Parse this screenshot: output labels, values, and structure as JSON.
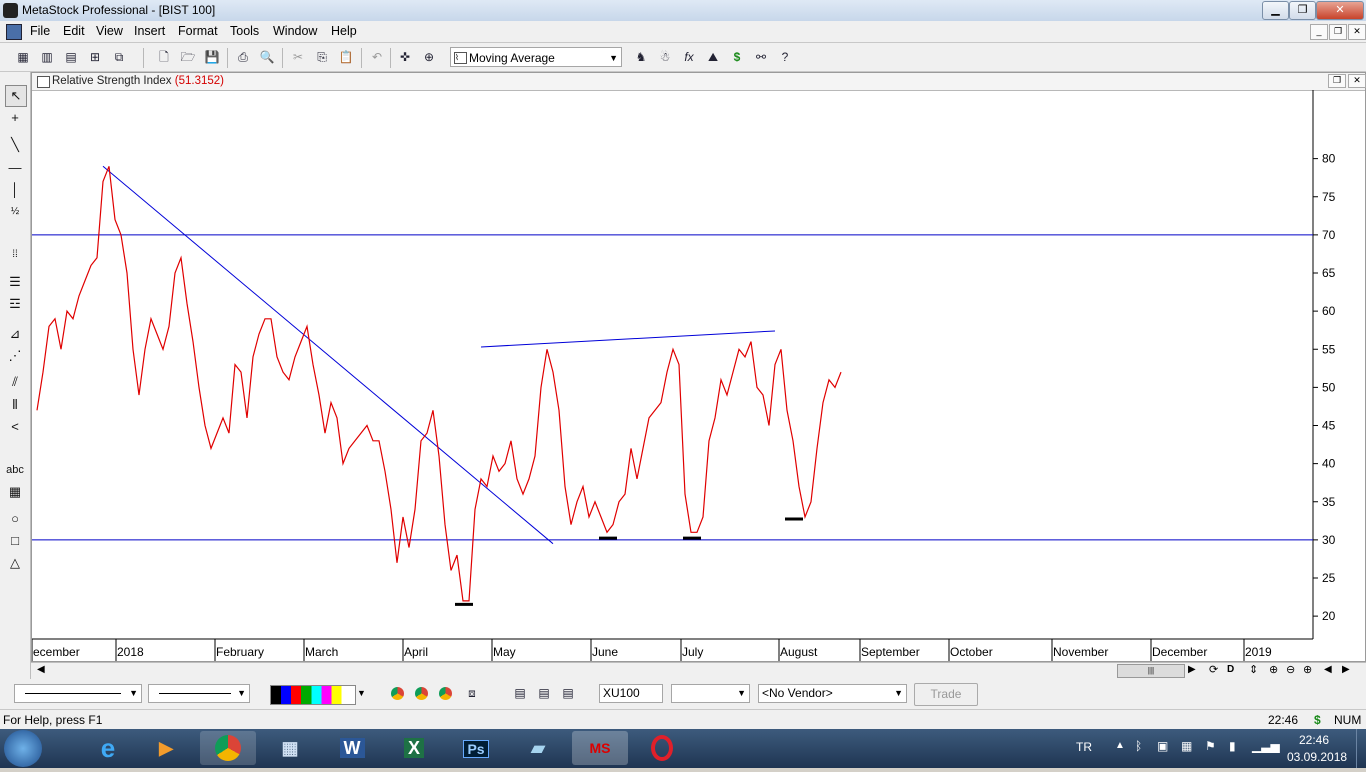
{
  "window": {
    "title": "MetaStock Professional - [BIST 100]"
  },
  "menu": [
    "File",
    "Edit",
    "View",
    "Insert",
    "Format",
    "Tools",
    "Window",
    "Help"
  ],
  "toolbar": {
    "indicator": "Moving Average"
  },
  "chart_window": {
    "title": "Relative Strength Index",
    "value": "(51.3152)"
  },
  "chart_data": {
    "type": "line",
    "title": "Relative Strength Index (51.3152)",
    "ylim": [
      17,
      89
    ],
    "y_ticks": [
      20,
      25,
      30,
      35,
      40,
      45,
      50,
      55,
      60,
      65,
      70,
      75,
      80
    ],
    "x_tick_labels": [
      "ecember",
      "2018",
      "February",
      "March",
      "April",
      "May",
      "June",
      "July",
      "August",
      "September",
      "October",
      "November",
      "December",
      "2019"
    ],
    "reference_lines": [
      30,
      70
    ],
    "series": [
      {
        "values": [
          47,
          52,
          58,
          59,
          55,
          60,
          59,
          62,
          64,
          66,
          67,
          77,
          79,
          72,
          70,
          65,
          55,
          49,
          55,
          59,
          57,
          55,
          58,
          65,
          67,
          61,
          56,
          50,
          45,
          42,
          44,
          46,
          44,
          53,
          52,
          46,
          54,
          57,
          59,
          59,
          54,
          52,
          51,
          54,
          56,
          58,
          53,
          49,
          44,
          48,
          46,
          40,
          42,
          43,
          44,
          45,
          43,
          43,
          39,
          34,
          27,
          33,
          29,
          34,
          43,
          44,
          47,
          41,
          32,
          26,
          28,
          22,
          22,
          34,
          38,
          37,
          41,
          39,
          40,
          43,
          38,
          36,
          38,
          41,
          50,
          55,
          52,
          47,
          37,
          32,
          35,
          37,
          33,
          35,
          33,
          31,
          32,
          35,
          36,
          42,
          38,
          42,
          46,
          47,
          48,
          52,
          55,
          53,
          36,
          31,
          31,
          33,
          43,
          46,
          51,
          49,
          52,
          55,
          54,
          56,
          50,
          49,
          45,
          53,
          55,
          47,
          43,
          37,
          33,
          35,
          42,
          48,
          51,
          50,
          52
        ],
        "color": "#e00000"
      }
    ],
    "trendlines": [
      {
        "from": [
          11,
          79
        ],
        "to": [
          86,
          29.5
        ]
      },
      {
        "from": [
          74,
          55.3
        ],
        "to": [
          123,
          57.4
        ]
      }
    ],
    "support_marks": [
      {
        "index": 71,
        "value": 21.8
      },
      {
        "index": 95,
        "value": 30.5
      },
      {
        "index": 109,
        "value": 30.5
      },
      {
        "index": 126,
        "value": 33
      }
    ]
  },
  "bottom": {
    "symbol": "XU100",
    "vendor": "<No Vendor>",
    "trade": "Trade"
  },
  "status": {
    "help": "For Help, press F1",
    "time": "22:46",
    "currency": "$",
    "num": "NUM"
  },
  "taskbar": {
    "lang": "TR",
    "time": "22:46",
    "date": "03.09.2018"
  }
}
